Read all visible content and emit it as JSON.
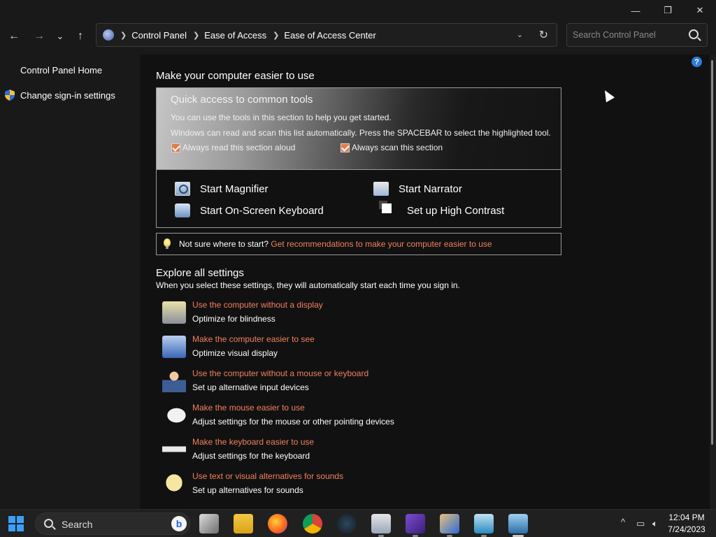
{
  "window": {
    "controls": {
      "minimize": "—",
      "restore": "❐",
      "close": "✕"
    }
  },
  "nav": {
    "back": "←",
    "forward": "→",
    "recent": "⌄",
    "up": "↑",
    "breadcrumbs": [
      "Control Panel",
      "Ease of Access",
      "Ease of Access Center"
    ],
    "search_placeholder": "Search Control Panel"
  },
  "sidebar": {
    "home": "Control Panel Home",
    "signin": "Change sign-in settings"
  },
  "main": {
    "title": "Make your computer easier to use",
    "quick_access": {
      "title": "Quick access to common tools",
      "line1": "You can use the tools in this section to help you get started.",
      "line2": "Windows can read and scan this list automatically.  Press the SPACEBAR to select the highlighted tool.",
      "check_read": "Always read this section aloud",
      "check_scan": "Always scan this section",
      "check_read_checked": true,
      "check_scan_checked": true
    },
    "tools": {
      "magnifier": "Start Magnifier",
      "narrator": "Start Narrator",
      "keyboard": "Start On-Screen Keyboard",
      "contrast": "Set up High Contrast"
    },
    "tip": {
      "prefix": "Not sure where to start?",
      "link": "Get recommendations to make your computer easier to use"
    },
    "explore": {
      "title": "Explore all settings",
      "subtitle": "When you select these settings, they will automatically start each time you sign in.",
      "items": [
        {
          "title": "Use the computer without a display",
          "desc": "Optimize for blindness"
        },
        {
          "title": "Make the computer easier to see",
          "desc": "Optimize visual display"
        },
        {
          "title": "Use the computer without a mouse or keyboard",
          "desc": "Set up alternative input devices"
        },
        {
          "title": "Make the mouse easier to use",
          "desc": "Adjust settings for the mouse or other pointing devices"
        },
        {
          "title": "Make the keyboard easier to use",
          "desc": "Adjust settings for the keyboard"
        },
        {
          "title": "Use text or visual alternatives for sounds",
          "desc": "Set up alternatives for sounds"
        }
      ]
    },
    "help": "?"
  },
  "taskbar": {
    "search_label": "Search",
    "bing": "b",
    "chevron": "^",
    "time": "12:04 PM",
    "date": "7/24/2023"
  },
  "colors": {
    "link": "#f0805e",
    "checkbox": "#e07b4a",
    "help": "#2d7cd6",
    "start": "#3aa0ff"
  }
}
